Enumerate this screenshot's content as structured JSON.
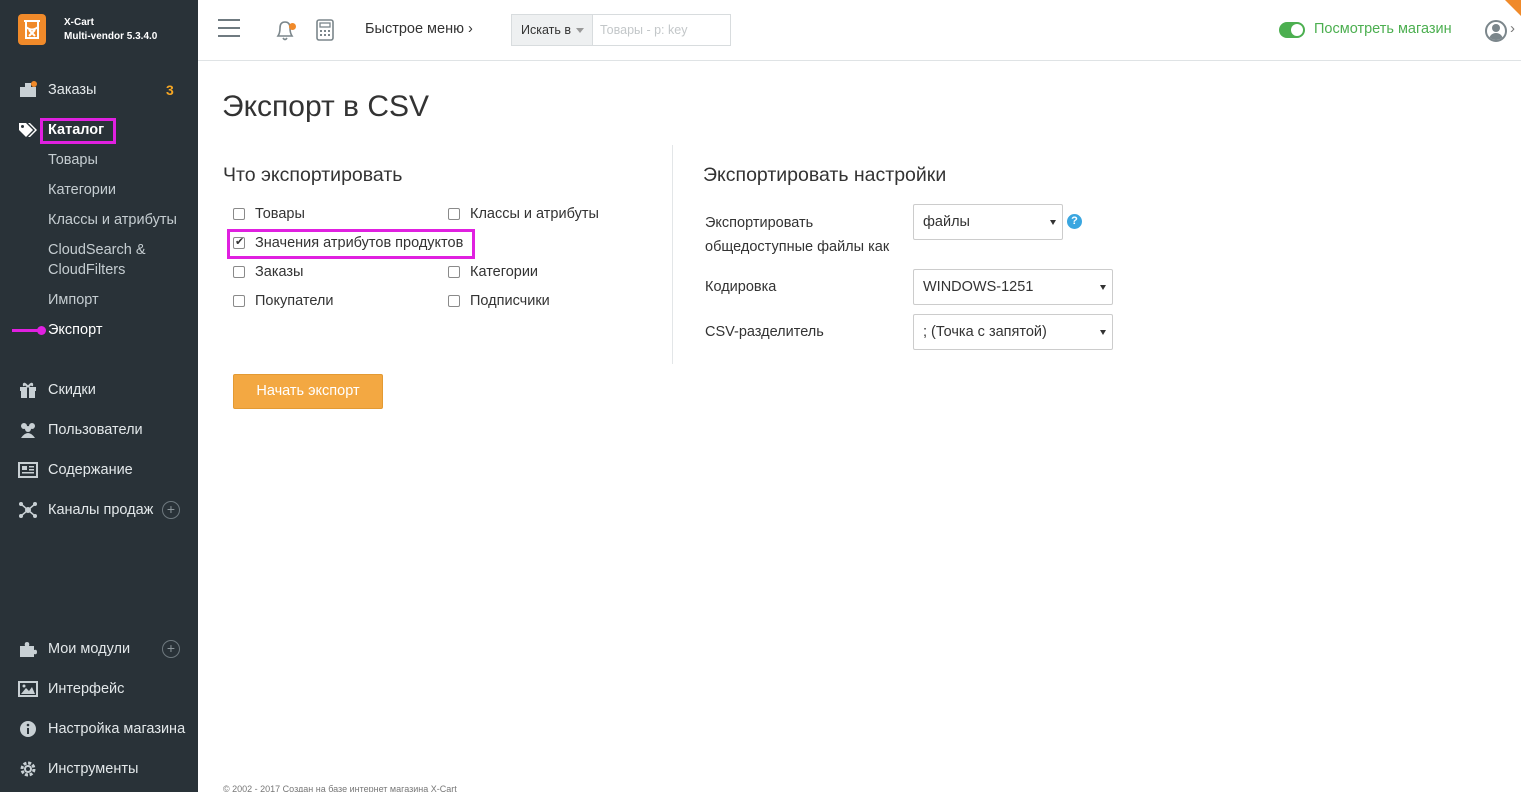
{
  "brand": {
    "name": "X-Cart",
    "version": "Multi-vendor 5.3.4.0",
    "accent": "#f08a2a"
  },
  "sidebar": {
    "orders": {
      "label": "Заказы",
      "badge": "3"
    },
    "catalog": {
      "label": "Каталог"
    },
    "catalog_items": [
      "Товары",
      "Категории",
      "Классы и атрибуты",
      "CloudSearch &",
      "CloudFilters",
      "Импорт",
      "Экспорт"
    ],
    "discounts": "Скидки",
    "users": "Пользователи",
    "content": "Содержание",
    "sales_channels": "Каналы продаж",
    "my_modules": "Мои модули",
    "interface": "Интерфейс",
    "store_setup": "Настройка магазина",
    "tools": "Инструменты",
    "plus": "+"
  },
  "topbar": {
    "quick_menu": "Быстрое меню ›",
    "search_in": "Искать в",
    "search_placeholder": "Товары - p: key",
    "view_store": "Посмотреть магазин",
    "chevron": "›"
  },
  "main": {
    "title": "Экспорт в CSV",
    "what_title": "Что экспортировать",
    "options": [
      {
        "label": "Товары",
        "checked": false
      },
      {
        "label": "Классы и атрибуты",
        "checked": false
      },
      {
        "label": "Значения атрибутов продуктов",
        "checked": true
      },
      {
        "label": "Заказы",
        "checked": false
      },
      {
        "label": "Категории",
        "checked": false
      },
      {
        "label": "Покупатели",
        "checked": false
      },
      {
        "label": "Подписчики",
        "checked": false
      }
    ],
    "settings_title": "Экспортировать настройки",
    "settings": {
      "files_label_1": "Экспортировать",
      "files_label_2": "общедоступные файлы как",
      "files_value": "файлы",
      "help": "?",
      "encoding_label": "Кодировка",
      "encoding_value": "WINDOWS-1251",
      "delimiter_label": "CSV-разделитель",
      "delimiter_value": "; (Точка с запятой)"
    },
    "start_button": "Начать экспорт"
  },
  "footer": "© 2002 - 2017 Создан на базе интернет магазина X-Cart"
}
